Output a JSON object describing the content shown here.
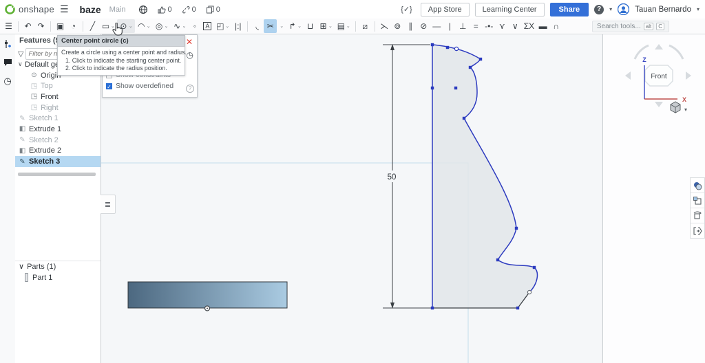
{
  "app": {
    "brand": "onshape",
    "document_title": "baze",
    "workspace": "Main",
    "counters": {
      "likes": "0",
      "links": "0",
      "copies": "0"
    },
    "app_store_label": "App Store",
    "learning_center_label": "Learning Center",
    "share_label": "Share",
    "help_label": "?",
    "user_name": "Tauan Bernardo",
    "code_icon": "{✓}"
  },
  "glyphs": {
    "hamburger": "☰",
    "caret_down": "⌄",
    "chevron_down": "∨",
    "funnel": "▽",
    "variables": "ǂ",
    "comment": "⬤",
    "history": "◷",
    "clock": "◷",
    "close": "✕",
    "check": "✓",
    "question": "?",
    "flyout_list": "≣",
    "cube_caret": "▾"
  },
  "toolbar": {
    "search_placeholder": "Search tools...",
    "shortcut_alt": "alt",
    "shortcut_key": "C",
    "tools": [
      {
        "name": "feature-list-toggle",
        "glyph": "☰"
      },
      {
        "name": "undo",
        "glyph": "↶"
      },
      {
        "name": "redo",
        "glyph": "↷"
      },
      {
        "name": "sketch",
        "glyph": "▣"
      },
      {
        "name": "extrude",
        "glyph": "◔"
      },
      {
        "name": "line",
        "glyph": "╱"
      },
      {
        "name": "corner-rectangle",
        "glyph": "▭"
      },
      {
        "name": "center-point-circle",
        "glyph": "⊙"
      },
      {
        "name": "arc",
        "glyph": "◠"
      },
      {
        "name": "ellipse",
        "glyph": "◎"
      },
      {
        "name": "spline",
        "glyph": "∿"
      },
      {
        "name": "point",
        "glyph": "◦"
      },
      {
        "name": "text",
        "glyph": "A"
      },
      {
        "name": "use-project",
        "glyph": "◰"
      },
      {
        "name": "mirror",
        "glyph": "|:|"
      },
      {
        "name": "fillet",
        "glyph": "◟"
      },
      {
        "name": "trim",
        "glyph": "✂"
      },
      {
        "name": "extend",
        "glyph": "↱"
      },
      {
        "name": "split",
        "glyph": "⊔"
      },
      {
        "name": "pattern",
        "glyph": "⊞"
      },
      {
        "name": "insert-dxf",
        "glyph": "▤"
      },
      {
        "name": "construction",
        "glyph": "⧄"
      },
      {
        "name": "coincident",
        "glyph": "⋋"
      },
      {
        "name": "concentric",
        "glyph": "⊚"
      },
      {
        "name": "parallel",
        "glyph": "∥"
      },
      {
        "name": "tangent",
        "glyph": "⊘"
      },
      {
        "name": "horizontal",
        "glyph": "—"
      },
      {
        "name": "vertical",
        "glyph": "|"
      },
      {
        "name": "perpendicular",
        "glyph": "⊥"
      },
      {
        "name": "equal",
        "glyph": "="
      },
      {
        "name": "midpoint",
        "glyph": "-•-"
      },
      {
        "name": "pierce",
        "glyph": "⋎"
      },
      {
        "name": "normal",
        "glyph": "∨"
      },
      {
        "name": "symmetric",
        "glyph": "ΣΧ"
      },
      {
        "name": "fix",
        "glyph": "▬"
      },
      {
        "name": "curvature",
        "glyph": "∩"
      }
    ]
  },
  "tooltip": {
    "title": "Center point circle (c)",
    "line1": "Create a circle using a center point and radius.",
    "line2": "1. Click to indicate the starting center point.",
    "line3": "2. Click to indicate the radius position."
  },
  "dialog": {
    "show_constraints_label": "Show constraints",
    "show_overdefined_label": "Show overdefined"
  },
  "features_panel": {
    "header": "Features (9)",
    "filter_placeholder": "Filter by name or type",
    "items": [
      {
        "label": "Default geometry",
        "icon": "",
        "state": "normal"
      },
      {
        "label": "Origin",
        "icon": "⊙",
        "state": "normal"
      },
      {
        "label": "Top",
        "icon": "◳",
        "state": "hidden"
      },
      {
        "label": "Front",
        "icon": "◳",
        "state": "normal"
      },
      {
        "label": "Right",
        "icon": "◳",
        "state": "hidden"
      },
      {
        "label": "Sketch 1",
        "icon": "✎",
        "state": "hidden"
      },
      {
        "label": "Extrude 1",
        "icon": "◧",
        "state": "normal"
      },
      {
        "label": "Sketch 2",
        "icon": "✎",
        "state": "hidden"
      },
      {
        "label": "Extrude 2",
        "icon": "◧",
        "state": "normal"
      },
      {
        "label": "Sketch 3",
        "icon": "✎",
        "state": "selected"
      }
    ],
    "parts_header": "Parts (1)",
    "parts": [
      {
        "label": "Part 1"
      }
    ]
  },
  "viewcube": {
    "face": "Front",
    "z_label": "Z",
    "x_label": "X"
  },
  "canvas": {
    "dimension_label": "50"
  },
  "colors": {
    "sketch_blue": "#2e3cc0",
    "accent_blue": "#2a6fd6",
    "share_button": "#3470d8",
    "selection_highlight": "#b5d8f2",
    "close_red": "#e03a2f",
    "canvas_bg": "#f5f7f9"
  }
}
